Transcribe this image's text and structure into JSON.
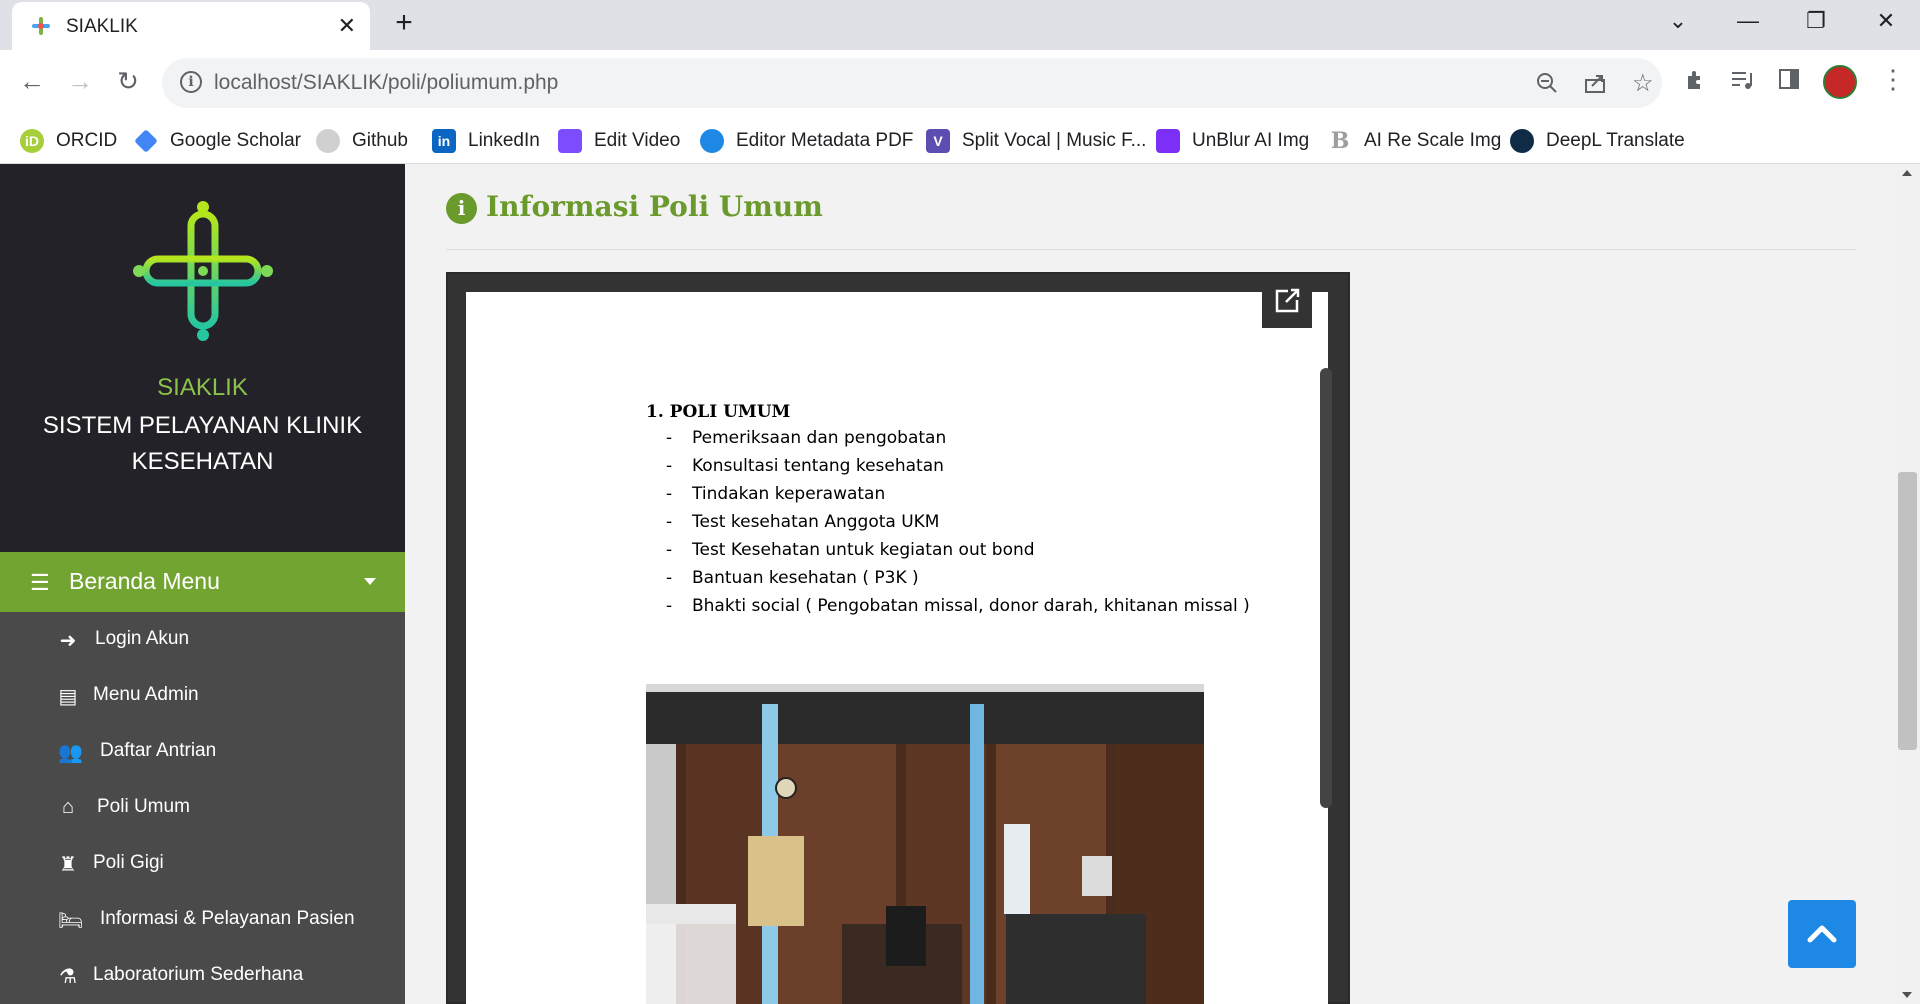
{
  "browser": {
    "tab_title": "SIAKLIK",
    "tab_close": "✕",
    "new_tab": "+",
    "url": "localhost/SIAKLIK/poli/poliumum.php",
    "bookmarks": [
      {
        "label": "ORCID",
        "icon": "orcid-icon",
        "color": "#a6ce39"
      },
      {
        "label": "Google Scholar",
        "icon": "google-scholar-icon",
        "color": "#4285f4"
      },
      {
        "label": "Github",
        "icon": "github-icon",
        "color": "#24292e"
      },
      {
        "label": "LinkedIn",
        "icon": "linkedin-icon",
        "color": "#0a66c2"
      },
      {
        "label": "Edit Video",
        "icon": "edit-video-icon",
        "color": "#7c4dff"
      },
      {
        "label": "Editor Metadata PDF",
        "icon": "editor-metadata-pdf-icon",
        "color": "#1e88e5"
      },
      {
        "label": "Split Vocal | Music F...",
        "icon": "split-vocal-icon",
        "color": "#5c4db1"
      },
      {
        "label": "UnBlur AI Img",
        "icon": "unblur-icon",
        "color": "#7b2ff7"
      },
      {
        "label": "AI Re Scale Img",
        "icon": "ai-rescale-icon",
        "color": "#9e9e9e"
      },
      {
        "label": "DeepL Translate",
        "icon": "deepl-icon",
        "color": "#0f2b46"
      }
    ]
  },
  "sidebar": {
    "brand": "SIAKLIK",
    "brand_sub": "SISTEM PELAYANAN KLINIK KESEHATAN",
    "menu_header": "Beranda Menu",
    "items": [
      {
        "label": "Login Akun",
        "icon": "sign-in-icon"
      },
      {
        "label": "Menu Admin",
        "icon": "book-icon"
      },
      {
        "label": "Daftar Antrian",
        "icon": "users-icon"
      },
      {
        "label": "Poli Umum",
        "icon": "home-icon"
      },
      {
        "label": "Poli Gigi",
        "icon": "tooth-icon"
      },
      {
        "label": "Informasi & Pelayanan Pasien",
        "icon": "bed-icon"
      },
      {
        "label": "Laboratorium Sederhana",
        "icon": "flask-icon"
      }
    ]
  },
  "main": {
    "title": "Informasi Poli Umum",
    "document": {
      "heading": "1.  POLI UMUM",
      "items": [
        "Pemeriksaan dan pengobatan",
        "Konsultasi tentang kesehatan",
        "Tindakan keperawatan",
        "Test kesehatan Anggota UKM",
        "Test Kesehatan untuk kegiatan out bond",
        "Bantuan kesehatan ( P3K )",
        "Bhakti social ( Pengobatan missal, donor darah, khitanan missal )"
      ]
    }
  },
  "colors": {
    "accent_green": "#72a431",
    "title_green": "#6a9a2b",
    "sidebar_dark": "#222228",
    "sidebar_menu": "#4a4a4a",
    "back_to_top": "#1e88e5"
  }
}
